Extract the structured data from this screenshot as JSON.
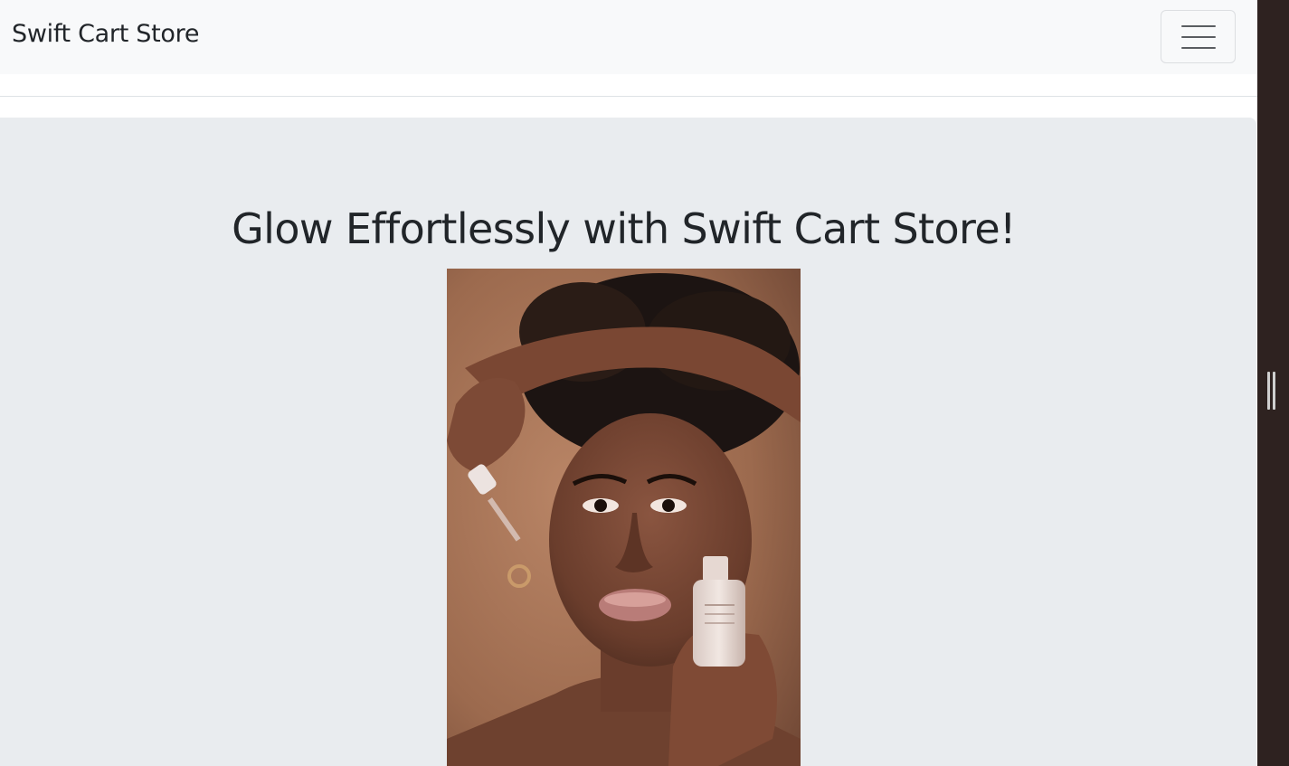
{
  "navbar": {
    "brand": "Swift Cart Store",
    "toggler_icon": "hamburger-menu-icon"
  },
  "hero": {
    "title": "Glow Effortlessly with Swift Cart Store!",
    "image": {
      "subject": "woman-applying-face-serum-photo"
    }
  },
  "colors": {
    "navbar_bg": "#f8f9fa",
    "hero_bg": "#e9ecef",
    "text": "#212529",
    "side_panel": "#2e2220"
  }
}
